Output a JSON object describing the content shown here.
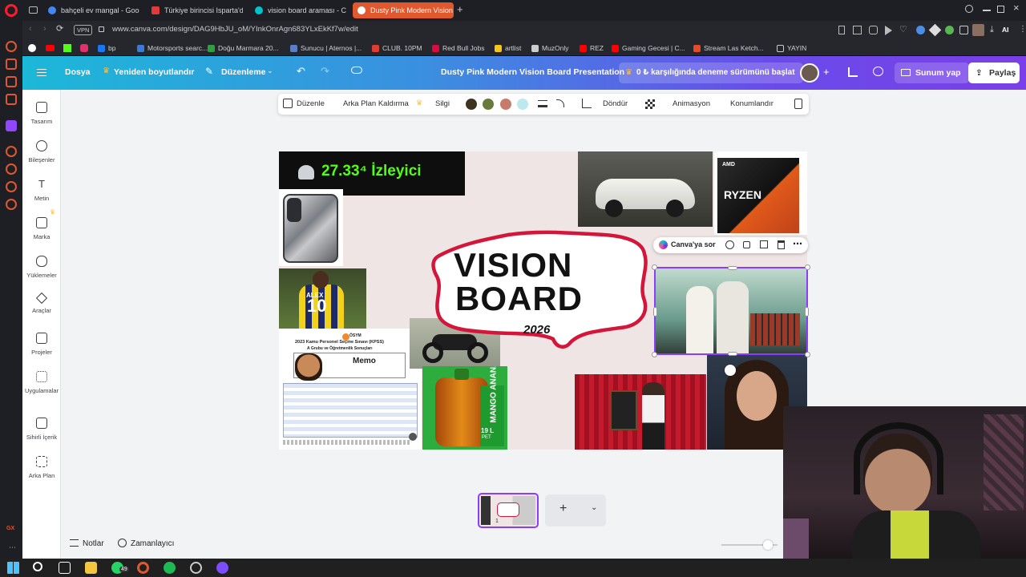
{
  "browser": {
    "tabs": [
      {
        "label": "bahçeli ev mangal - Goog",
        "favicon_color": "#4285f4",
        "active": false
      },
      {
        "label": "Türkiye birincisi Isparta'da",
        "favicon_color": "#e23a3a",
        "active": false
      },
      {
        "label": "vision board araması - Ca",
        "favicon_color": "#00c4cc",
        "active": false
      },
      {
        "label": "Dusty Pink Modern Vision",
        "favicon_color": "#7d2ae8",
        "active": true
      }
    ],
    "vpn_label": "VPN",
    "url": "www.canva.com/design/DAG9HbJU_oM/YInkOnrAgn683YLxEkKf7w/edit",
    "bookmarks": [
      {
        "label": "bp",
        "color": "#1877f2"
      },
      {
        "label": "Motorsports searc...",
        "color": "#3a7bd5"
      },
      {
        "label": "Doğu Marmara 20...",
        "color": "#2ea043"
      },
      {
        "label": "Sunucu | Aternos |...",
        "color": "#5a7ec7"
      },
      {
        "label": "CLUB. 10PM",
        "color": "#e03c31"
      },
      {
        "label": "Red Bull Jobs",
        "color": "#db0a40"
      },
      {
        "label": "artlist",
        "color": "#f5c518"
      },
      {
        "label": "MuzOnly",
        "color": "#cccccc"
      },
      {
        "label": "REZ",
        "color": "#ff0000"
      },
      {
        "label": "Gaming Gecesi | C...",
        "color": "#ff0000"
      },
      {
        "label": "Stream Las Ketch...",
        "color": "#e34c26"
      },
      {
        "label": "YAYIN",
        "color": "#cccccc"
      }
    ],
    "ai_label": "AI"
  },
  "canva_header": {
    "file_label": "Dosya",
    "resize_label": "Yeniden boyutlandır",
    "edit_label": "Düzenleme",
    "design_title": "Dusty Pink Modern Vision Board Presentation",
    "trial_label": "0 ₺ karşılığında deneme sürümünü başlat",
    "present_label": "Sunum yap",
    "share_label": "Paylaş"
  },
  "left_panel": {
    "items": [
      {
        "label": "Tasarım",
        "icon": "layout-icon"
      },
      {
        "label": "Bileşenler",
        "icon": "shapes-icon"
      },
      {
        "label": "Metin",
        "icon": "text-icon"
      },
      {
        "label": "Marka",
        "icon": "brand-icon"
      },
      {
        "label": "Yüklemeler",
        "icon": "upload-icon"
      },
      {
        "label": "Araçlar",
        "icon": "tools-icon"
      },
      {
        "label": "Projeler",
        "icon": "folder-icon"
      },
      {
        "label": "Uygulamalar",
        "icon": "apps-icon"
      },
      {
        "label": "Sihirli İçerik",
        "icon": "magic-icon"
      },
      {
        "label": "Arka Plan",
        "icon": "background-icon"
      }
    ]
  },
  "context_toolbar": {
    "edit_label": "Düzenle",
    "bg_remove_label": "Arka Plan Kaldırma",
    "eraser_label": "Silgi",
    "swatches": [
      "#3f3320",
      "#6b7a3c",
      "#c57c6c",
      "#bde9ee"
    ],
    "rotate_label": "Döndür",
    "animate_label": "Animasyon",
    "position_label": "Konumlandır"
  },
  "canvas": {
    "viewer_count": "27.33⁴ İzleyici",
    "vision_line1": "VISION",
    "vision_line2": "BOARD",
    "year": "2026",
    "doc_header": "ÖSYM",
    "doc_title": "2023 Kamu Personel Seçme Sınavı (KPSS)",
    "doc_subtitle": "A Grubu ve Öğretmenlik Sonuçları",
    "memo_label": "Memo",
    "jersey_name": "ALEX",
    "jersey_number": "10",
    "bottle_text": "MANGO ANANAS",
    "bottle_size": "19 L",
    "bottle_sub": "PET",
    "cpu_brand": "AMD",
    "cpu_name": "RYZEN",
    "ask_canva_label": "Canva'ya sor"
  },
  "bottom_bar": {
    "notes_label": "Notlar",
    "timer_label": "Zamanlayıcı",
    "thumb_page_number": "1"
  },
  "taskbar": {
    "whatsapp_badge": "49",
    "icons": [
      {
        "name": "windows-icon",
        "color": "#4cc2ff"
      },
      {
        "name": "search-icon",
        "color": "#ffffff"
      },
      {
        "name": "task-view-icon",
        "color": "#ffffff"
      },
      {
        "name": "explorer-icon",
        "color": "#f5c542"
      },
      {
        "name": "whatsapp-icon",
        "color": "#25d366"
      },
      {
        "name": "opera-icon",
        "color": "#e0582d"
      },
      {
        "name": "spotify-icon",
        "color": "#1db954"
      },
      {
        "name": "obs-icon",
        "color": "#cccccc"
      },
      {
        "name": "discord-icon",
        "color": "#7c4dff"
      }
    ]
  }
}
